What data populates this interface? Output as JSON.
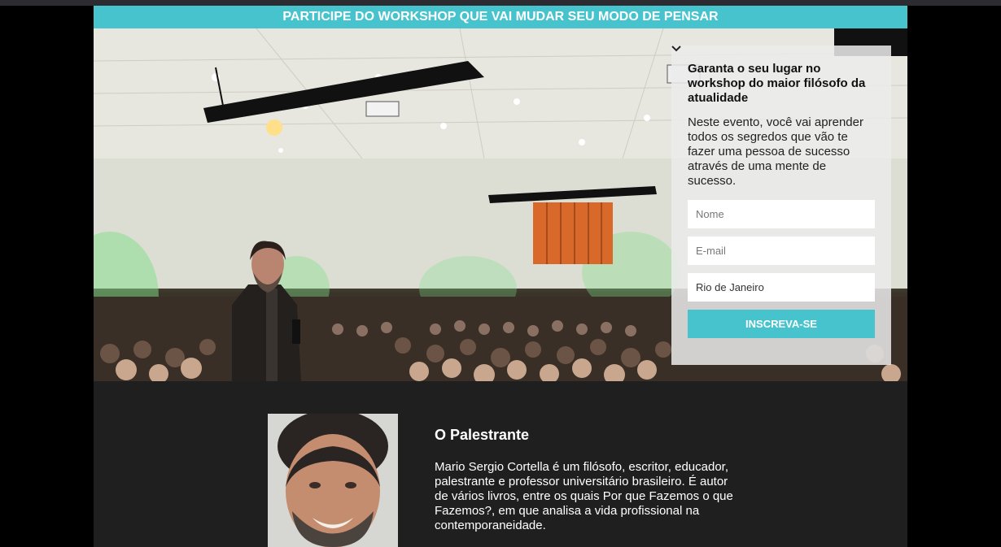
{
  "banner": {
    "text": "PARTICIPE DO WORKSHOP QUE VAI MUDAR SEU MODO DE PENSAR"
  },
  "form": {
    "title": "Garanta o seu lugar no workshop do maior filósofo da atualidade",
    "description": "Neste evento, você vai aprender todos os segredos que vão te fazer uma pessoa de sucesso através de uma mente de sucesso.",
    "name_placeholder": "Nome",
    "email_placeholder": "E-mail",
    "city_selected": "Rio de Janeiro",
    "submit_label": "INSCREVA-SE"
  },
  "speaker": {
    "title": "O Palestrante",
    "bio": "Mario Sergio Cortella é um filósofo, escritor, educador, palestrante e professor universitário brasileiro. É autor de vários livros, entre os quais Por que Fazemos o que Fazemos?, em que analisa a vida profissional na contemporaneidade."
  },
  "colors": {
    "accent": "#47c3cd",
    "page_background": "#1f1f1f"
  }
}
